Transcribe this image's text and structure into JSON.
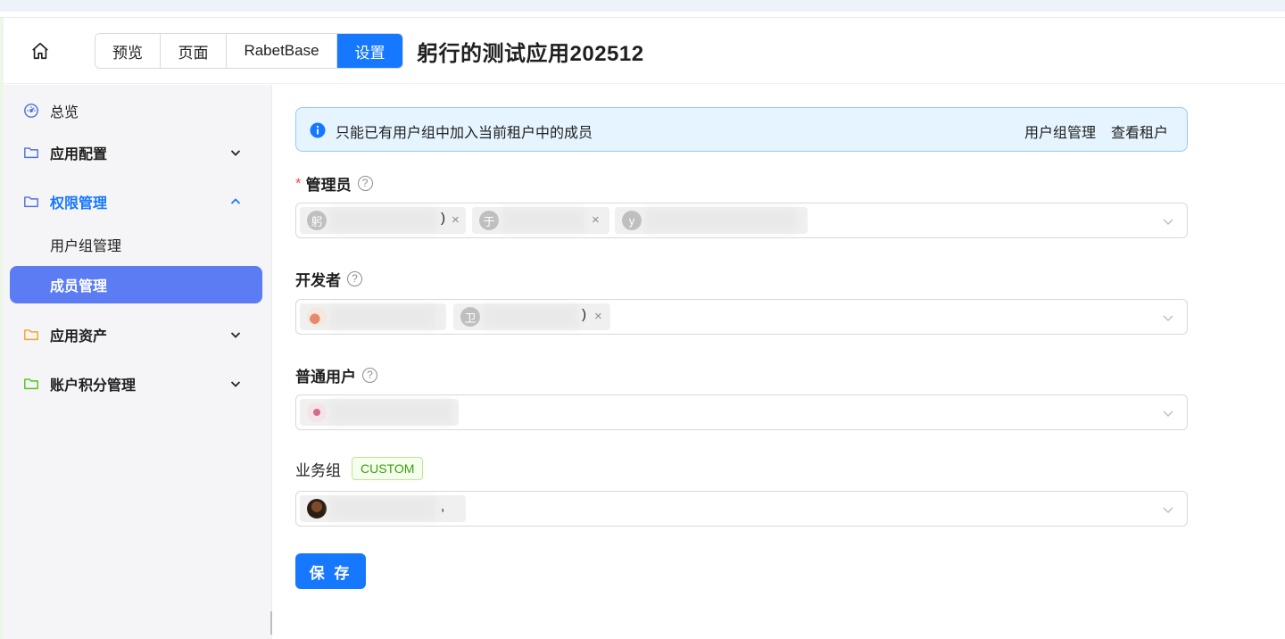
{
  "header": {
    "tabs": [
      {
        "label": "预览"
      },
      {
        "label": "页面"
      },
      {
        "label": "RabetBase"
      },
      {
        "label": "设置"
      }
    ],
    "active_tab": "设置",
    "app_title": "躬行的测试应用202512"
  },
  "sidebar": {
    "items": [
      {
        "label": "总览",
        "icon": "dashboard-icon"
      },
      {
        "label": "应用配置",
        "icon": "folder-icon",
        "expanded": false
      },
      {
        "label": "权限管理",
        "icon": "folder-icon",
        "expanded": true
      },
      {
        "label": "用户组管理"
      },
      {
        "label": "成员管理",
        "active": true
      },
      {
        "label": "应用资产",
        "icon": "folder-icon",
        "expanded": false
      },
      {
        "label": "账户积分管理",
        "icon": "folder-icon",
        "expanded": false
      }
    ],
    "colors": {
      "folder_blue": "#4f74d9",
      "folder_orange": "#f5a524",
      "folder_green": "#52c41a",
      "active_bg": "#5b7cf2"
    }
  },
  "alert": {
    "message": "只能已有用户组中加入当前租户中的成员",
    "links": [
      "用户组管理",
      "查看租户"
    ]
  },
  "fields": {
    "admin": {
      "label": "管理员",
      "required": "*",
      "help": "?",
      "chips": [
        {
          "avatar": "躬",
          "tail": ")"
        },
        {
          "avatar": "于",
          "tail": ""
        },
        {
          "avatar": "y",
          "tail": ""
        }
      ]
    },
    "developer": {
      "label": "开发者",
      "help": "?",
      "chips": [
        {
          "avatar": "",
          "tail": ""
        },
        {
          "avatar": "卫",
          "tail": ")"
        }
      ]
    },
    "user": {
      "label": "普通用户",
      "help": "?",
      "chips": [
        {
          "avatar": "",
          "tail": ""
        }
      ]
    },
    "business": {
      "label": "业务组",
      "tag": "CUSTOM",
      "chips": [
        {
          "avatar": "",
          "tail": ","
        }
      ]
    }
  },
  "remove_glyph": "×",
  "save_label": "保 存",
  "colors": {
    "primary": "#1677ff",
    "alert_bg": "#e6f4ff",
    "alert_border": "#91caff",
    "required": "#ff4d4f",
    "tag_green": "#389e0d"
  }
}
